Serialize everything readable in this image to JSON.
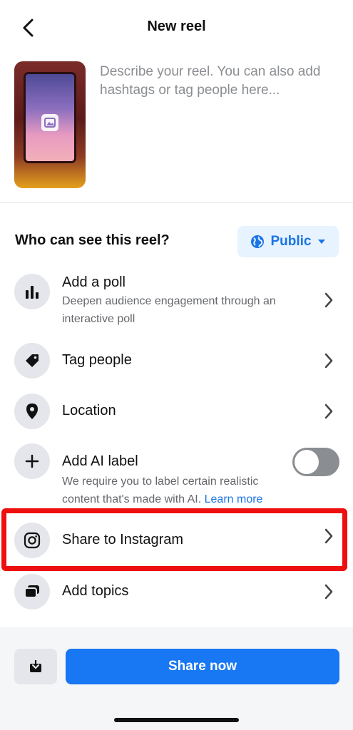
{
  "header": {
    "title": "New reel",
    "back_icon": "chevron-left-icon"
  },
  "composer": {
    "placeholder": "Describe your reel. You can also add hashtags or tag people here..."
  },
  "audience": {
    "label": "Who can see this reel?",
    "button_label": "Public",
    "icon": "globe-icon"
  },
  "rows": {
    "poll": {
      "title": "Add a poll",
      "subtitle": "Deepen audience engagement through an interactive poll",
      "icon": "bar-chart-icon"
    },
    "tag": {
      "title": "Tag people",
      "icon": "tag-icon"
    },
    "location": {
      "title": "Location",
      "icon": "location-pin-icon"
    },
    "ai_label": {
      "title": "Add AI label",
      "subtitle": "We require you to label certain realistic content that's made with AI.",
      "link": "Learn more",
      "toggle_on": false,
      "icon": "plus-icon"
    },
    "instagram": {
      "title": "Share to Instagram",
      "icon": "instagram-icon"
    },
    "topics": {
      "title": "Add topics",
      "icon": "topics-icon"
    }
  },
  "footer": {
    "share_label": "Share now",
    "save_icon": "download-icon"
  },
  "colors": {
    "accent": "#1877f2",
    "highlight": "#ee0f0f",
    "public_bg": "#e7f3ff"
  }
}
